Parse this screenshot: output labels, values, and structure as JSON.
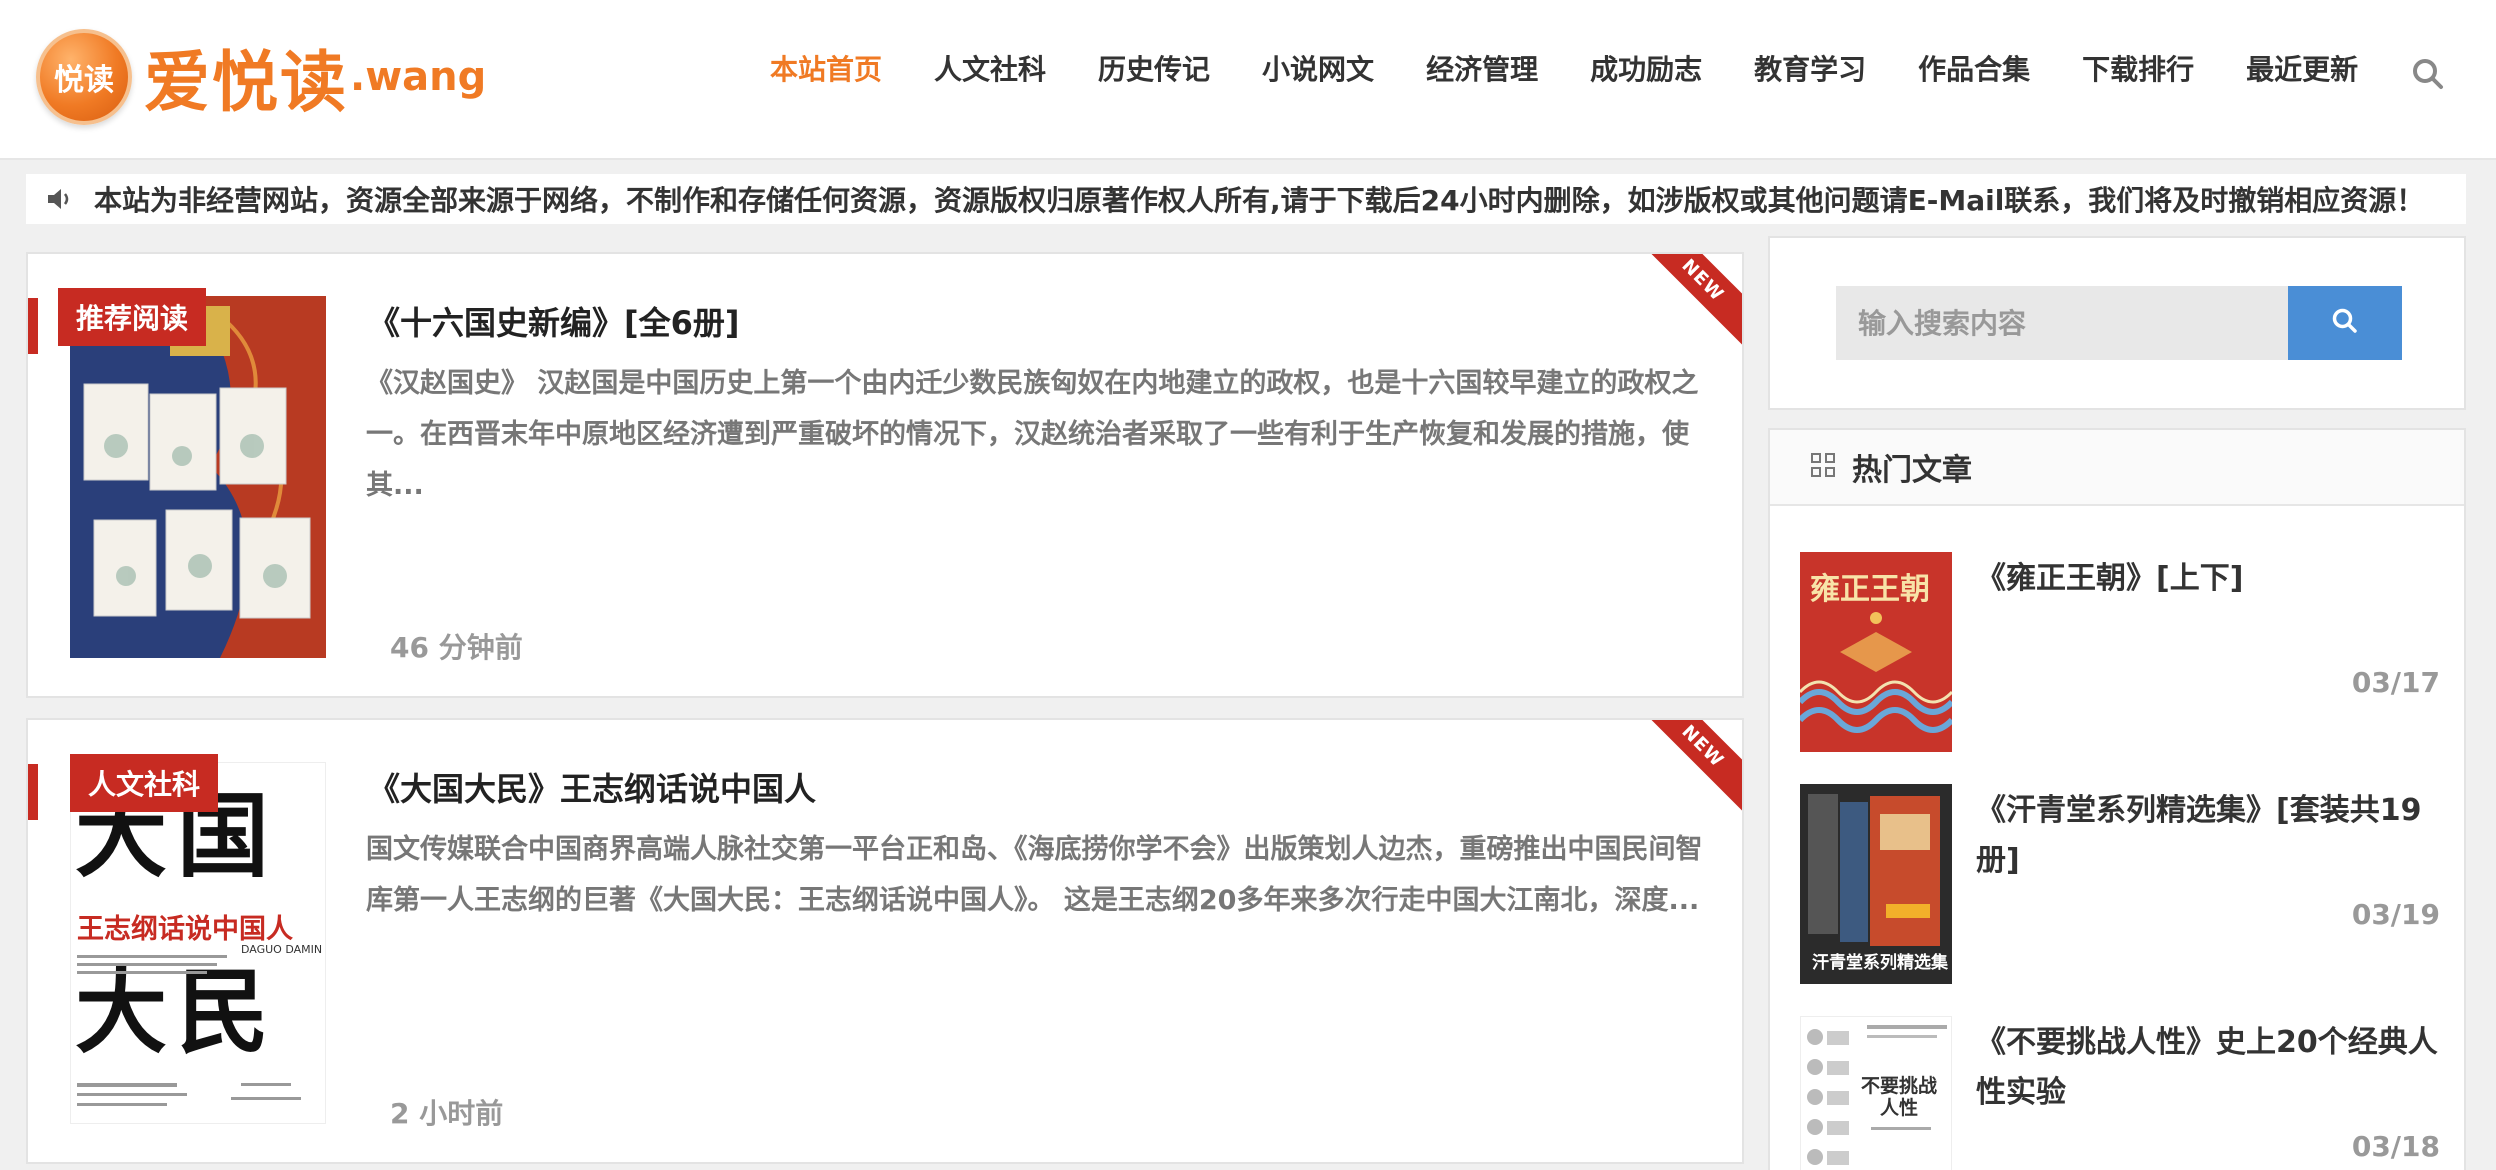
{
  "header": {
    "logo_badge": "悦读",
    "logo_text": "爱悦读",
    "logo_suffix": ".wang",
    "nav": [
      {
        "label": "本站首页",
        "active": true
      },
      {
        "label": "人文社科"
      },
      {
        "label": "历史传记"
      },
      {
        "label": "小说网文"
      },
      {
        "label": "经济管理"
      },
      {
        "label": "成功励志"
      },
      {
        "label": "教育学习"
      },
      {
        "label": "作品合集"
      },
      {
        "label": "下载排行"
      },
      {
        "label": "最近更新"
      }
    ],
    "search_icon": "search-icon"
  },
  "notice": {
    "icon": "speaker-icon",
    "text": "本站为非经营网站，资源全部来源于网络，不制作和存储任何资源，资源版权归原著作权人所有,请于下载后24小时内删除，如涉版权或其他问题请E-Mail联系，我们将及时撤销相应资源！"
  },
  "articles": [
    {
      "category": "推荐阅读",
      "badge": "NEW",
      "title": "《十六国史新编》[全6册]",
      "desc": "《汉赵国史》 汉赵国是中国历史上第一个由内迁少数民族匈奴在内地建立的政权，也是十六国较早建立的政权之一。在西晋末年中原地区经济遭到严重破坏的情况下，汉赵统治者采取了一些有利于生产恢复和发展的措施，使其...",
      "time": "46 分钟前"
    },
    {
      "category": "人文社科",
      "badge": "NEW",
      "title": "《大国大民》王志纲话说中国人",
      "desc": "国文传媒联合中国商界高端人脉社交第一平台正和岛、《海底捞你学不会》出版策划人边杰，重磅推出中国民间智库第一人王志纲的巨著《大国大民：王志纲话说中国人》。 这是王志纲20多年来多次行走中国大江南北，深度...",
      "time": "2 小时前",
      "cover_big1": "大国",
      "cover_sub": "王志纲话说中国人",
      "cover_latin": "DAGUO DAMIN",
      "cover_big2": "大民"
    }
  ],
  "sidebar": {
    "search_placeholder": "输入搜索内容",
    "hot_title": "热门文章",
    "hot": [
      {
        "title": "《雍正王朝》[上下]",
        "date": "03/17",
        "cover_text": "雍正王朝"
      },
      {
        "title": "《汗青堂系列精选集》[套装共19册]",
        "date": "03/19",
        "cover_text": "汗青堂系列精选集"
      },
      {
        "title": "《不要挑战人性》史上20个经典人性实验",
        "date": "03/18",
        "cover_text": "不要挑战人性"
      }
    ]
  },
  "colors": {
    "accent": "#f07a24",
    "category_red": "#c72b22",
    "search_blue": "#4a8ed6"
  }
}
